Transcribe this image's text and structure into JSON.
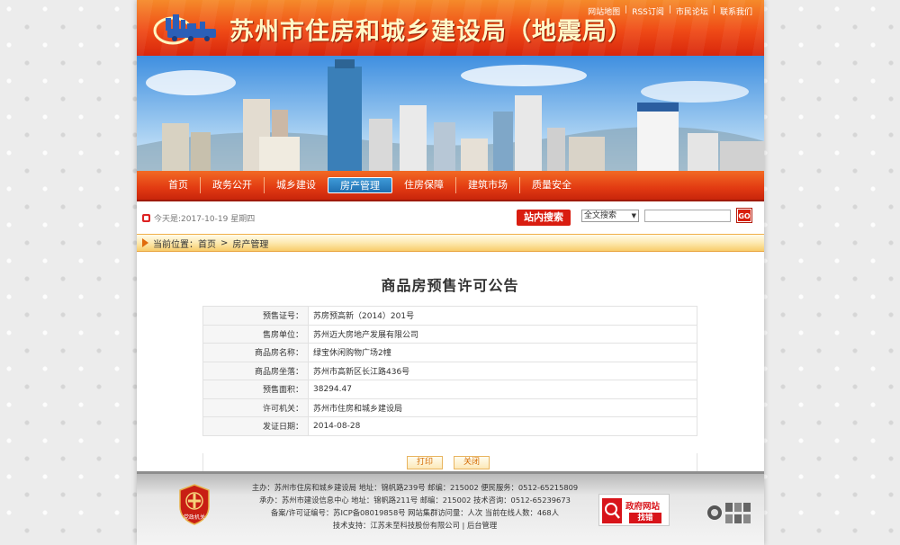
{
  "header": {
    "site_title": "苏州市住房和城乡建设局（地震局）",
    "links": [
      "网站地图",
      "RSS订阅",
      "市民论坛",
      "联系我们"
    ],
    "logo_icon": "building-train-logo-icon"
  },
  "nav": {
    "items": [
      "首页",
      "政务公开",
      "城乡建设",
      "房产管理",
      "住房保障",
      "建筑市场",
      "质量安全"
    ],
    "active_index": 3
  },
  "date_bar": {
    "text": "今天是:2017-10-19 星期四"
  },
  "search": {
    "badge": "站内搜索",
    "select_value": "全文搜索",
    "input_value": "",
    "go_label": "GO"
  },
  "breadcrumb": {
    "prefix": "当前位置：",
    "home": "首页",
    "sep": ">",
    "current": "房产管理"
  },
  "document": {
    "title": "商品房预售许可公告",
    "rows": [
      {
        "label": "预售证号：",
        "value": "苏房预高新（2014）201号"
      },
      {
        "label": "售房单位：",
        "value": "苏州迈大房地产发展有限公司"
      },
      {
        "label": "商品房名称：",
        "value": "绿宝休闲购物广场2幢"
      },
      {
        "label": "商品房坐落：",
        "value": "苏州市高新区长江路436号"
      },
      {
        "label": "预售面积：",
        "value": "38294.47"
      },
      {
        "label": "许可机关：",
        "value": "苏州市住房和城乡建设局"
      },
      {
        "label": "发证日期：",
        "value": " 2014-08-28"
      }
    ],
    "print_label": "打印",
    "close_label": "关闭"
  },
  "footer": {
    "lines": [
      "主办：苏州市住房和城乡建设局  地址：锦帆路239号  邮编：215002  便民服务：0512-65215809",
      "承办：苏州市建设信息中心  地址：锦帆路211号  邮编：215002  技术咨询：0512-65239673",
      "备案/许可证编号：苏ICP备08019858号  网站集群访问量：人次    当前在线人数：468人",
      "技术支持：江苏未至科技股份有限公司 | 后台管理"
    ],
    "badge_text": "党政机关",
    "gov_badge_line1": "政府网站",
    "gov_badge_line2": "找错"
  },
  "colors": {
    "header_red": "#ef4a16",
    "nav_red": "#e23a12",
    "nav_active_blue": "#1f6fb0",
    "search_red": "#d91d10",
    "crumb_orange": "#f8cc6a"
  }
}
